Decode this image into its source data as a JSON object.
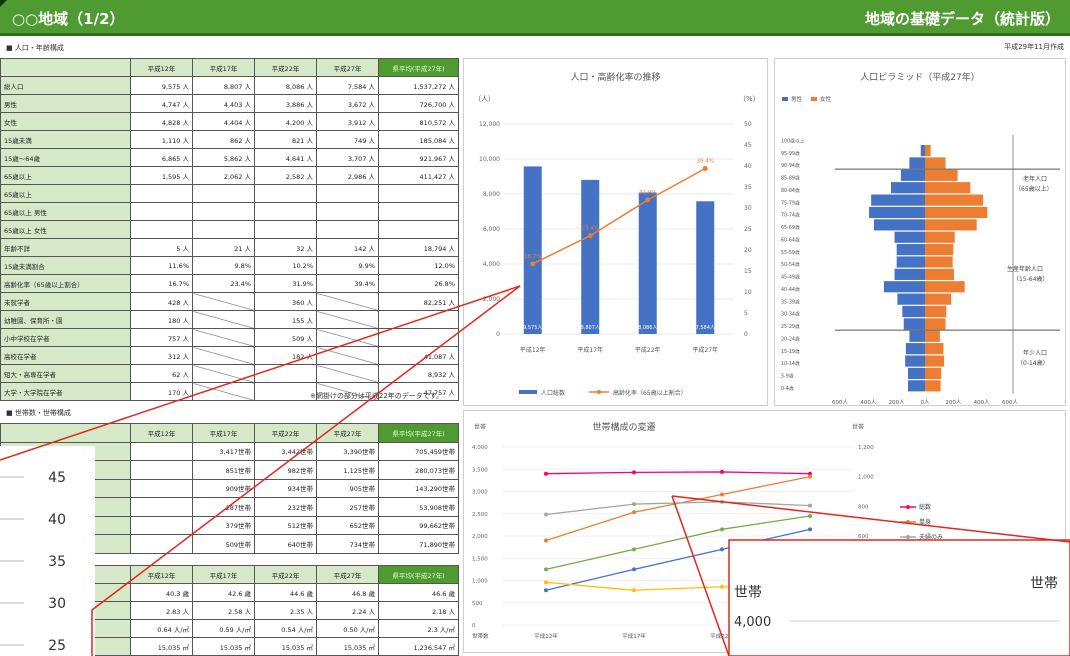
{
  "header": {
    "title": "○○地域（1/2）",
    "right": "地域の基礎データ（統計版）"
  },
  "sections": {
    "pop": "■ 人口・年齢構成",
    "hh": "■ 世帯数・世帯構成"
  },
  "date": "平成29年11月作成",
  "pop_table": {
    "headers": [
      "",
      "平成12年",
      "平成17年",
      "平成22年",
      "平成27年",
      "県平均(平成27年)"
    ],
    "rows": [
      [
        "総人口",
        "9,575 人",
        "8,807 人",
        "8,086 人",
        "7,584 人",
        "1,537,272 人"
      ],
      [
        "男性",
        "4,747 人",
        "4,403 人",
        "3,886 人",
        "3,672 人",
        "726,700 人"
      ],
      [
        "女性",
        "4,828 人",
        "4,404 人",
        "4,200 人",
        "3,912 人",
        "810,572 人"
      ],
      [
        "15歳未満",
        "1,110 人",
        "862 人",
        "821 人",
        "749 人",
        "185,084 人"
      ],
      [
        "15歳～64歳",
        "6,865 人",
        "5,862 人",
        "4,641 人",
        "3,707 人",
        "921,967 人"
      ],
      [
        "65歳以上",
        "1,595 人",
        "2,062 人",
        "2,582 人",
        "2,986 人",
        "411,427 人"
      ],
      [
        "65歳以上",
        "",
        "",
        "",
        "",
        ""
      ],
      [
        " 65歳以上 男性",
        "",
        "",
        "",
        "",
        ""
      ],
      [
        " 65歳以上 女性",
        "",
        "",
        "",
        "",
        ""
      ],
      [
        "年齢不詳",
        "5 人",
        "21 人",
        "32 人",
        "142 人",
        "18,794 人"
      ],
      [
        "15歳未満割合",
        "11.6%",
        "9.8%",
        "10.2%",
        "9.9%",
        "12.0%"
      ],
      [
        "高齢化率（65歳以上割合）",
        "16.7%",
        "23.4%",
        "31.9%",
        "39.4%",
        "26.8%"
      ],
      [
        "未就学者",
        "428 人",
        "",
        "360 人",
        "",
        "82,251 人"
      ],
      [
        "幼稚園、保育所・園",
        "180 人",
        "",
        "155 人",
        "",
        "",
        ""
      ],
      [
        "小中学校在学者",
        "757 人",
        "",
        "509 人",
        "",
        "",
        ""
      ],
      [
        "高校在学者",
        "312 人",
        "",
        "182 人",
        "",
        "41,087 人"
      ],
      [
        "短大・高専在学者",
        "62 人",
        "",
        "",
        "",
        "8,932 人"
      ],
      [
        "大学・大学院在学者",
        "170 人",
        "",
        "",
        "",
        "47,757 人"
      ]
    ]
  },
  "note": "※網掛けの部分は平成22年のデータです。",
  "hh_table": {
    "headers": [
      "",
      "平成12年",
      "平成17年",
      "平成22年",
      "平成27年",
      "県平均(平成27年)"
    ],
    "rows": [
      [
        "",
        "",
        "3,417世帯",
        "3,442世帯",
        "3,390世帯",
        "705,459世帯"
      ],
      [
        "",
        "",
        "851世帯",
        "982世帯",
        "1,125世帯",
        "280,073世帯"
      ],
      [
        "",
        "",
        "909世帯",
        "934世帯",
        "905世帯",
        "143,290世帯"
      ],
      [
        "",
        "",
        "287世帯",
        "232世帯",
        "257世帯",
        "53,908世帯"
      ],
      [
        "",
        "",
        "379世帯",
        "512世帯",
        "652世帯",
        "99,662世帯"
      ],
      [
        "",
        "",
        "509世帯",
        "640世帯",
        "734世帯",
        "71,890世帯"
      ]
    ]
  },
  "misc_table": {
    "headers": [
      "",
      "平成12年",
      "平成17年",
      "平成22年",
      "平成27年",
      "県平均(平成27年)"
    ],
    "rows": [
      [
        "",
        "40.3 歳",
        "42.6 歳",
        "44.6 歳",
        "46.8 歳",
        "46.6 歳"
      ],
      [
        "",
        "2.83 人",
        "2.58 人",
        "2.35 人",
        "2.24 人",
        "2.18 人"
      ],
      [
        "",
        "0.64 人/㎡",
        "0.59 人/㎡",
        "0.54 人/㎡",
        "0.50 人/㎡",
        "2.3 人/㎡"
      ],
      [
        "",
        "15,035 ㎡",
        "15,035 ㎡",
        "15,035 ㎡",
        "15,035 ㎡",
        "1,236,547 ㎡"
      ]
    ]
  },
  "chart_data": [
    {
      "type": "bar",
      "title": "人口・高齢化率の推移",
      "y_unit_left": "（人）",
      "y_unit_right": "（%）",
      "categories": [
        "平成12年",
        "平成17年",
        "平成22年",
        "平成27年"
      ],
      "series": [
        {
          "name": "人口総数",
          "kind": "bar",
          "axis": "left",
          "values": [
            9575,
            8807,
            8086,
            7584
          ],
          "color": "#4472c4",
          "labels": [
            "9,575人",
            "8,807人",
            "8,086人",
            "7,584人"
          ]
        },
        {
          "name": "高齢化率（65歳以上割合）",
          "kind": "line",
          "axis": "right",
          "values": [
            16.7,
            23.4,
            31.9,
            39.4
          ],
          "color": "#ed7d31",
          "labels": [
            "16.7%",
            "23.4%",
            "31.9%",
            "39.4%"
          ]
        }
      ],
      "ylim_left": [
        0,
        12000
      ],
      "yticks_left": [
        "0",
        "2,000",
        "4,000",
        "6,000",
        "8,000",
        "10,000",
        "12,000"
      ],
      "ylim_right": [
        0,
        50
      ],
      "yticks_right": [
        "0",
        "5",
        "10",
        "15",
        "20",
        "25",
        "30",
        "35",
        "40",
        "45",
        "50"
      ]
    },
    {
      "type": "bar",
      "title": "人口ピラミッド（平成27年）",
      "orientation": "horizontal",
      "legend": [
        "男性",
        "女性"
      ],
      "colors": [
        "#4472c4",
        "#ed7d31"
      ],
      "categories": [
        "0-4歳",
        "5-9歳",
        "10-14歳",
        "15-19歳",
        "20-24歳",
        "25-29歳",
        "30-34歳",
        "35-39歳",
        "40-44歳",
        "45-49歳",
        "50-54歳",
        "55-59歳",
        "60-64歳",
        "65-69歳",
        "70-74歳",
        "75-79歳",
        "80-84歳",
        "85-89歳",
        "90-94歳",
        "95-99歳",
        "100歳以上"
      ],
      "male": [
        120,
        120,
        140,
        135,
        110,
        150,
        160,
        195,
        290,
        215,
        200,
        200,
        215,
        360,
        395,
        380,
        240,
        170,
        110,
        30,
        0
      ],
      "female": [
        110,
        115,
        135,
        130,
        105,
        145,
        150,
        185,
        280,
        205,
        195,
        200,
        210,
        365,
        440,
        410,
        320,
        230,
        145,
        40,
        0
      ],
      "xticks": [
        "600人",
        "400人",
        "200人",
        "0人",
        "200人",
        "400人",
        "600人"
      ],
      "xlim": [
        -600,
        600
      ],
      "annotations": [
        "老年人口",
        "（65歳以上）",
        "生産年齢人口",
        "（15-64歳）",
        "年少人口",
        "（0-14歳）"
      ]
    },
    {
      "type": "line",
      "title": "世帯構成の変遷",
      "y_unit_left": "世帯",
      "y_unit_right": "世帯",
      "categories": [
        "平成12年",
        "平成17年",
        "平成22年",
        "平成27年"
      ],
      "series": [
        {
          "name": "総数",
          "axis": "left",
          "values": [
            3400,
            3430,
            3440,
            3400
          ],
          "color": "#ff0066"
        },
        {
          "name": "単身",
          "axis": "right",
          "values": [
            570,
            760,
            880,
            1000
          ],
          "color": "#ed7d31"
        },
        {
          "name": "夫婦のみ",
          "axis": "right",
          "values": [
            745,
            815,
            830,
            805
          ],
          "color": "#a5a5a5"
        },
        {
          "name": "",
          "axis": "left",
          "values": [
            1250,
            1700,
            2150,
            2450
          ],
          "color": "#70ad47"
        },
        {
          "name": "",
          "axis": "left",
          "values": [
            780,
            1250,
            1700,
            2150
          ],
          "color": "#4472c4"
        },
        {
          "name": "",
          "axis": "left",
          "values": [
            960,
            780,
            860,
            800
          ],
          "color": "#ffc000"
        }
      ],
      "ylim_left": [
        0,
        4000
      ],
      "yticks_left": [
        "0",
        "500",
        "1,000",
        "1,500",
        "2,000",
        "2,500",
        "3,000",
        "3,500",
        "4,000"
      ],
      "ylim_right": [
        0,
        1200
      ],
      "yticks_right": [
        "200",
        "400",
        "600",
        "800",
        "1,000",
        "1,200"
      ],
      "x_unit": "世帯数"
    }
  ],
  "zoom": {
    "left_ticks": [
      "45",
      "40",
      "35",
      "30",
      "25"
    ],
    "right_label1": "世帯",
    "right_value": "4,000",
    "right_label2": "世帯"
  }
}
